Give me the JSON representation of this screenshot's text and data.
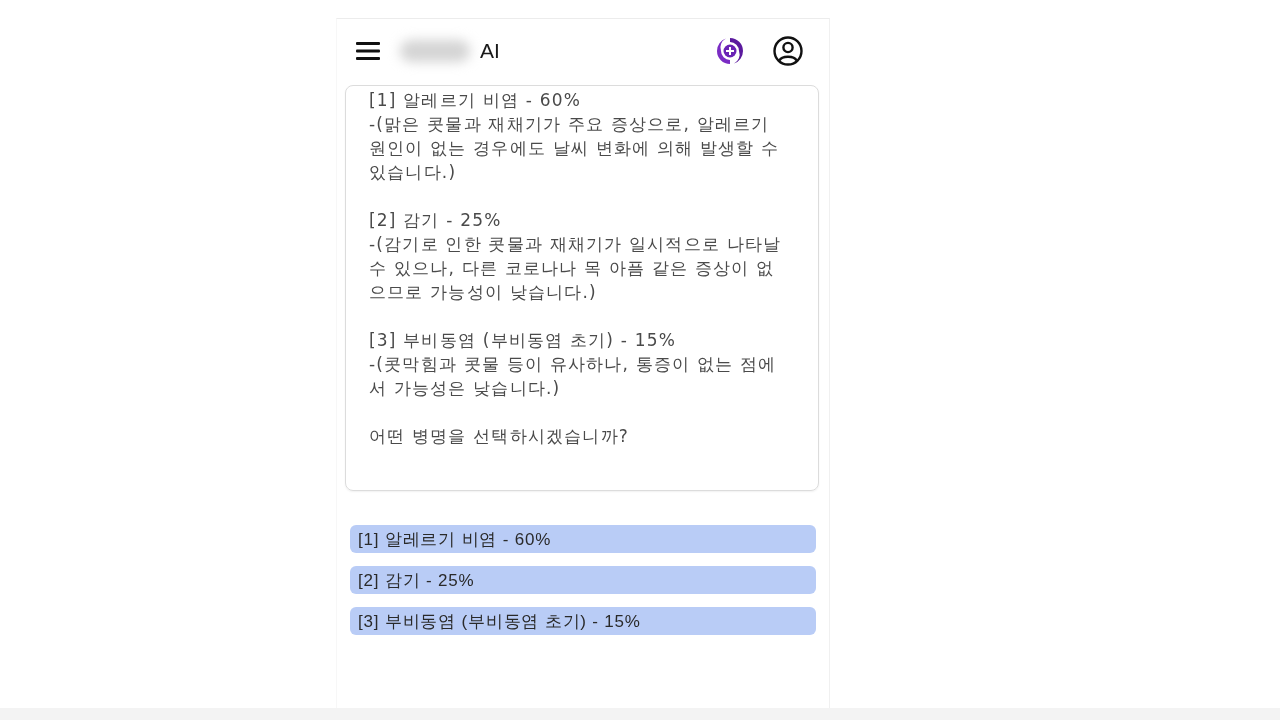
{
  "header": {
    "title": "AI"
  },
  "message": {
    "items": [
      {
        "heading": "[1] 알레르기 비염 - 60%",
        "detail": "-(맑은 콧물과 재채기가 주요 증상으로, 알레르기 원인이 없는 경우에도 날씨 변화에 의해 발생할 수 있습니다.)"
      },
      {
        "heading": "[2] 감기 - 25%",
        "detail": "-(감기로 인한 콧물과 재채기가 일시적으로 나타날 수 있으나, 다른 코로나나 목 아픔 같은 증상이 없으므로 가능성이 낮습니다.)"
      },
      {
        "heading": "[3] 부비동염 (부비동염 초기) - 15%",
        "detail": "-(콧막힘과 콧물 등이 유사하나, 통증이 없는 점에서 가능성은 낮습니다.)"
      }
    ],
    "question": "어떤 병명을 선택하시겠습니까?"
  },
  "options": [
    {
      "label": "[1] 알레르기 비염 - 60%"
    },
    {
      "label": "[2] 감기 - 25%"
    },
    {
      "label": "[3] 부비동염 (부비동염 초기) - 15%"
    }
  ]
}
